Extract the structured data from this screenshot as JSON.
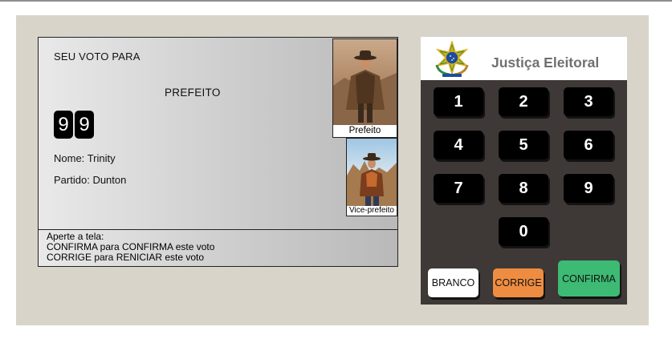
{
  "screen": {
    "heading": "SEU VOTO PARA",
    "office": "PREFEITO",
    "digits": [
      "9",
      "9"
    ],
    "name_label": "Nome:",
    "name_value": "Trinity",
    "party_label": "Partido:",
    "party_value": "Dunton",
    "main_photo_caption": "Prefeito",
    "vice_photo_caption": "Vice-prefeito",
    "instructions": {
      "line1": "Aperte a tela:",
      "line2": "CONFIRMA para CONFIRMA este voto",
      "line3": "CORRIGE para RENICIAR este voto"
    }
  },
  "keypad": {
    "title": "Justiça Eleitoral",
    "emblem_icon": "brazil-coat-of-arms-icon",
    "keys": [
      "1",
      "2",
      "3",
      "4",
      "5",
      "6",
      "7",
      "8",
      "9",
      "0"
    ],
    "branco_label": "BRANCO",
    "corrige_label": "CORRIGE",
    "confirma_label": "CONFIRMA"
  },
  "colors": {
    "booth_background": "#d9d4c9",
    "keypad_background": "#3e3936",
    "branco_button": "#ffffff",
    "corrige_button": "#ee8d41",
    "confirma_button": "#3dba73",
    "key_background": "#000000",
    "title_text": "#707070"
  }
}
